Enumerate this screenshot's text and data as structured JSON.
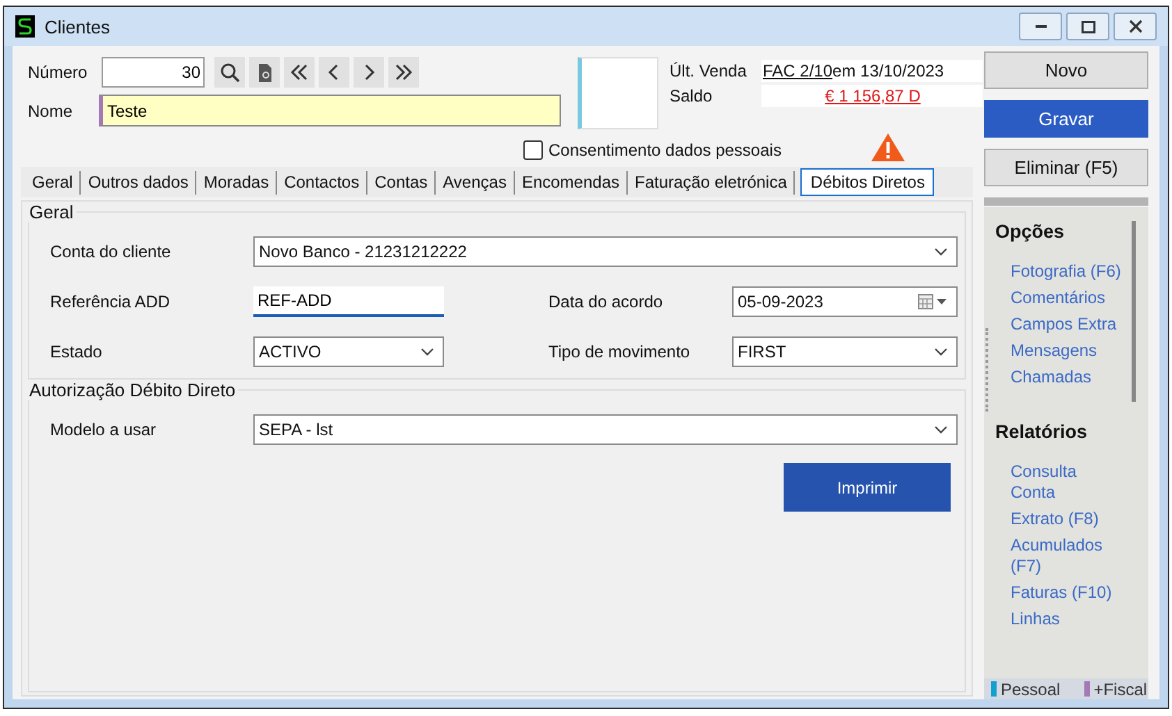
{
  "window": {
    "title": "Clientes"
  },
  "header": {
    "numero": {
      "label": "Número",
      "value": "30"
    },
    "nav_buttons": [
      {
        "kind": "search"
      },
      {
        "kind": "document"
      },
      {
        "kind": "first"
      },
      {
        "kind": "prev"
      },
      {
        "kind": "next"
      },
      {
        "kind": "last"
      }
    ],
    "nome": {
      "label": "Nome",
      "value": "Teste"
    },
    "ultima_venda": {
      "label": "Últ. Venda",
      "link": "FAC 2/10",
      "text": "em 13/10/2023"
    },
    "saldo": {
      "label": "Saldo",
      "value": "€ 1 156,87 D"
    },
    "consent": {
      "label": "Consentimento dados pessoais",
      "checked": false
    }
  },
  "tabs": [
    {
      "label": "Geral",
      "selected": false
    },
    {
      "label": "Outros dados",
      "selected": false
    },
    {
      "label": "Moradas",
      "selected": false
    },
    {
      "label": "Contactos",
      "selected": false
    },
    {
      "label": "Contas",
      "selected": false
    },
    {
      "label": "Avenças",
      "selected": false
    },
    {
      "label": "Encomendas",
      "selected": false
    },
    {
      "label": "Faturação eletrónica",
      "selected": false
    },
    {
      "label": "Débitos Diretos",
      "selected": true
    }
  ],
  "sections": [
    {
      "title": "Geral",
      "rows": [
        [
          {
            "label": "Conta do cliente",
            "kind": "combo",
            "value": "Novo Banco - 21231212222"
          }
        ],
        [
          {
            "label": "Referência ADD",
            "kind": "text",
            "value": "REF-ADD"
          },
          {
            "label": "Data do acordo",
            "kind": "date",
            "value": "05-09-2023"
          }
        ],
        [
          {
            "label": "Estado",
            "kind": "combo",
            "value": "ACTIVO"
          },
          {
            "label": "Tipo de movimento",
            "kind": "combo",
            "value": "FIRST"
          }
        ]
      ]
    },
    {
      "title": "Autorização Débito Direto",
      "rows": [
        [
          {
            "label": "Modelo a usar",
            "kind": "combo",
            "value": "SEPA - lst"
          }
        ]
      ],
      "button": "Imprimir"
    }
  ],
  "actions": [
    {
      "label": "Novo",
      "kind": "default"
    },
    {
      "label": "Gravar",
      "kind": "primary"
    },
    {
      "label": "Eliminar (F5)",
      "kind": "default"
    }
  ],
  "side_panel": {
    "groups": [
      {
        "title": "Opções",
        "links": [
          "Fotografia (F6)",
          "Comentários",
          "Campos Extra",
          "Mensagens",
          "Chamadas"
        ]
      },
      {
        "title": "Relatórios",
        "links": [
          "Consulta Conta",
          "Extrato (F8)",
          "Acumulados (F7)",
          "Faturas (F10)",
          "Linhas"
        ]
      }
    ]
  },
  "legend": [
    {
      "label": "Pessoal",
      "color": "#139fd0"
    },
    {
      "label": "+Fiscal",
      "color": "#a47ab6"
    }
  ]
}
